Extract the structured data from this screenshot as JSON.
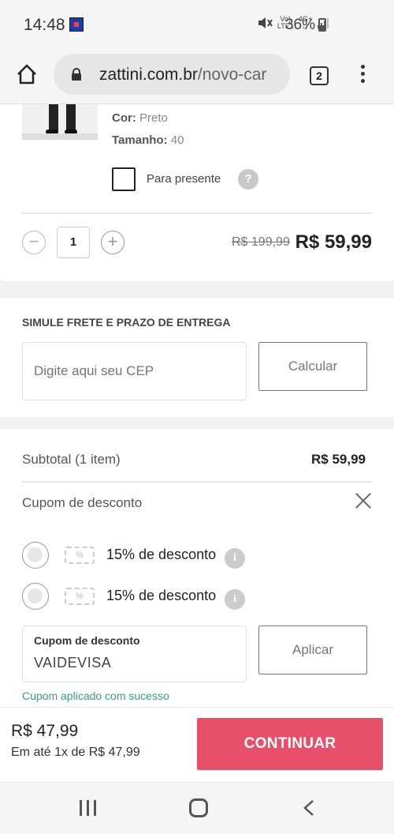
{
  "status": {
    "time": "14:48",
    "volte_top": "Vo)",
    "volte_bottom": "LTE1",
    "net_top": "4G+",
    "net_bottom": "↓↑",
    "battery": "36%"
  },
  "browser": {
    "url_domain": "zattini.com.br",
    "url_path": "/novo-car",
    "tab_count": "2"
  },
  "product": {
    "color_label": "Cor:",
    "color_value": "Preto",
    "size_label": "Tamanho:",
    "size_value": "40",
    "gift_label": "Para presente",
    "help_symbol": "?",
    "quantity": "1",
    "minus": "−",
    "plus": "+",
    "price_old": "R$ 199,99",
    "price_new": "R$ 59,99"
  },
  "shipping": {
    "title": "SIMULE FRETE E PRAZO DE ENTREGA",
    "cep_placeholder": "Digite aqui seu CEP",
    "calc_button": "Calcular"
  },
  "summary": {
    "subtotal_label": "Subtotal (1 item)",
    "subtotal_value": "R$ 59,99",
    "coupon_title": "Cupom de desconto",
    "coupons": [
      {
        "label": "15% de desconto",
        "ticket": "%"
      },
      {
        "label": "15% de desconto",
        "ticket": "%"
      }
    ],
    "info_symbol": "i",
    "coupon_input_label": "Cupom de desconto",
    "coupon_input_value": "VAIDEVISA",
    "apply_button": "Aplicar",
    "success_message": "Cupom aplicado com sucesso"
  },
  "checkout": {
    "total": "R$ 47,99",
    "installments": "Em até 1x de R$ 47,99",
    "continue_button": "CONTINUAR"
  },
  "colors": {
    "accent": "#e8506a",
    "success": "#2fa37a"
  }
}
